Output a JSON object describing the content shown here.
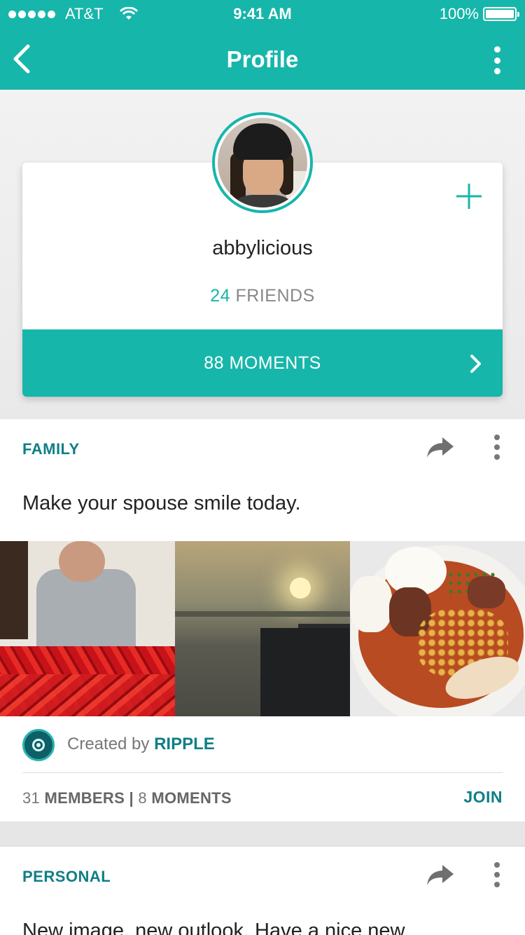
{
  "status_bar": {
    "carrier": "AT&T",
    "time": "9:41 AM",
    "battery": "100%"
  },
  "nav": {
    "title": "Profile"
  },
  "profile": {
    "username": "abbylicious",
    "friends_count": "24",
    "friends_label": "FRIENDS",
    "moments_label": "88 MOMENTS"
  },
  "posts": [
    {
      "category": "FAMILY",
      "text": "Make your spouse smile today.",
      "created_by_prefix": "Created by",
      "creator": "RIPPLE",
      "members_count": "31",
      "members_label": "MEMBERS",
      "moments_count": "8",
      "moments_label": "MOMENTS",
      "separator": "|",
      "join_label": "JOIN"
    },
    {
      "category": "PERSONAL",
      "text": "New image, new outlook. Have a nice new"
    }
  ],
  "colors": {
    "accent": "#17b6aa",
    "accent_dark": "#0f7f86"
  },
  "icons": [
    "back-arrow-icon",
    "more-vert-icon",
    "plus-icon",
    "chevron-right-icon",
    "share-icon",
    "ripple-logo-icon",
    "wifi-icon",
    "battery-icon"
  ]
}
